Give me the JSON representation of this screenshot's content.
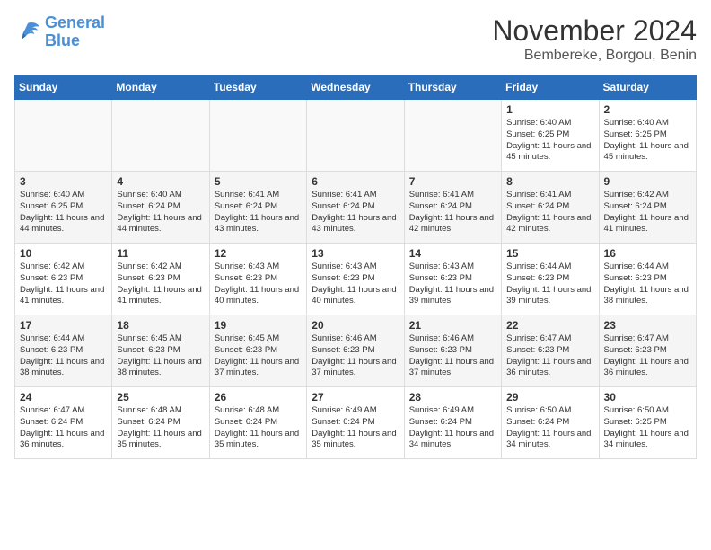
{
  "logo": {
    "line1": "General",
    "line2": "Blue"
  },
  "title": "November 2024",
  "subtitle": "Bembereke, Borgou, Benin",
  "days_of_week": [
    "Sunday",
    "Monday",
    "Tuesday",
    "Wednesday",
    "Thursday",
    "Friday",
    "Saturday"
  ],
  "weeks": [
    [
      {
        "day": "",
        "info": ""
      },
      {
        "day": "",
        "info": ""
      },
      {
        "day": "",
        "info": ""
      },
      {
        "day": "",
        "info": ""
      },
      {
        "day": "",
        "info": ""
      },
      {
        "day": "1",
        "info": "Sunrise: 6:40 AM\nSunset: 6:25 PM\nDaylight: 11 hours and 45 minutes."
      },
      {
        "day": "2",
        "info": "Sunrise: 6:40 AM\nSunset: 6:25 PM\nDaylight: 11 hours and 45 minutes."
      }
    ],
    [
      {
        "day": "3",
        "info": "Sunrise: 6:40 AM\nSunset: 6:25 PM\nDaylight: 11 hours and 44 minutes."
      },
      {
        "day": "4",
        "info": "Sunrise: 6:40 AM\nSunset: 6:24 PM\nDaylight: 11 hours and 44 minutes."
      },
      {
        "day": "5",
        "info": "Sunrise: 6:41 AM\nSunset: 6:24 PM\nDaylight: 11 hours and 43 minutes."
      },
      {
        "day": "6",
        "info": "Sunrise: 6:41 AM\nSunset: 6:24 PM\nDaylight: 11 hours and 43 minutes."
      },
      {
        "day": "7",
        "info": "Sunrise: 6:41 AM\nSunset: 6:24 PM\nDaylight: 11 hours and 42 minutes."
      },
      {
        "day": "8",
        "info": "Sunrise: 6:41 AM\nSunset: 6:24 PM\nDaylight: 11 hours and 42 minutes."
      },
      {
        "day": "9",
        "info": "Sunrise: 6:42 AM\nSunset: 6:24 PM\nDaylight: 11 hours and 41 minutes."
      }
    ],
    [
      {
        "day": "10",
        "info": "Sunrise: 6:42 AM\nSunset: 6:23 PM\nDaylight: 11 hours and 41 minutes."
      },
      {
        "day": "11",
        "info": "Sunrise: 6:42 AM\nSunset: 6:23 PM\nDaylight: 11 hours and 41 minutes."
      },
      {
        "day": "12",
        "info": "Sunrise: 6:43 AM\nSunset: 6:23 PM\nDaylight: 11 hours and 40 minutes."
      },
      {
        "day": "13",
        "info": "Sunrise: 6:43 AM\nSunset: 6:23 PM\nDaylight: 11 hours and 40 minutes."
      },
      {
        "day": "14",
        "info": "Sunrise: 6:43 AM\nSunset: 6:23 PM\nDaylight: 11 hours and 39 minutes."
      },
      {
        "day": "15",
        "info": "Sunrise: 6:44 AM\nSunset: 6:23 PM\nDaylight: 11 hours and 39 minutes."
      },
      {
        "day": "16",
        "info": "Sunrise: 6:44 AM\nSunset: 6:23 PM\nDaylight: 11 hours and 38 minutes."
      }
    ],
    [
      {
        "day": "17",
        "info": "Sunrise: 6:44 AM\nSunset: 6:23 PM\nDaylight: 11 hours and 38 minutes."
      },
      {
        "day": "18",
        "info": "Sunrise: 6:45 AM\nSunset: 6:23 PM\nDaylight: 11 hours and 38 minutes."
      },
      {
        "day": "19",
        "info": "Sunrise: 6:45 AM\nSunset: 6:23 PM\nDaylight: 11 hours and 37 minutes."
      },
      {
        "day": "20",
        "info": "Sunrise: 6:46 AM\nSunset: 6:23 PM\nDaylight: 11 hours and 37 minutes."
      },
      {
        "day": "21",
        "info": "Sunrise: 6:46 AM\nSunset: 6:23 PM\nDaylight: 11 hours and 37 minutes."
      },
      {
        "day": "22",
        "info": "Sunrise: 6:47 AM\nSunset: 6:23 PM\nDaylight: 11 hours and 36 minutes."
      },
      {
        "day": "23",
        "info": "Sunrise: 6:47 AM\nSunset: 6:23 PM\nDaylight: 11 hours and 36 minutes."
      }
    ],
    [
      {
        "day": "24",
        "info": "Sunrise: 6:47 AM\nSunset: 6:24 PM\nDaylight: 11 hours and 36 minutes."
      },
      {
        "day": "25",
        "info": "Sunrise: 6:48 AM\nSunset: 6:24 PM\nDaylight: 11 hours and 35 minutes."
      },
      {
        "day": "26",
        "info": "Sunrise: 6:48 AM\nSunset: 6:24 PM\nDaylight: 11 hours and 35 minutes."
      },
      {
        "day": "27",
        "info": "Sunrise: 6:49 AM\nSunset: 6:24 PM\nDaylight: 11 hours and 35 minutes."
      },
      {
        "day": "28",
        "info": "Sunrise: 6:49 AM\nSunset: 6:24 PM\nDaylight: 11 hours and 34 minutes."
      },
      {
        "day": "29",
        "info": "Sunrise: 6:50 AM\nSunset: 6:24 PM\nDaylight: 11 hours and 34 minutes."
      },
      {
        "day": "30",
        "info": "Sunrise: 6:50 AM\nSunset: 6:25 PM\nDaylight: 11 hours and 34 minutes."
      }
    ]
  ]
}
